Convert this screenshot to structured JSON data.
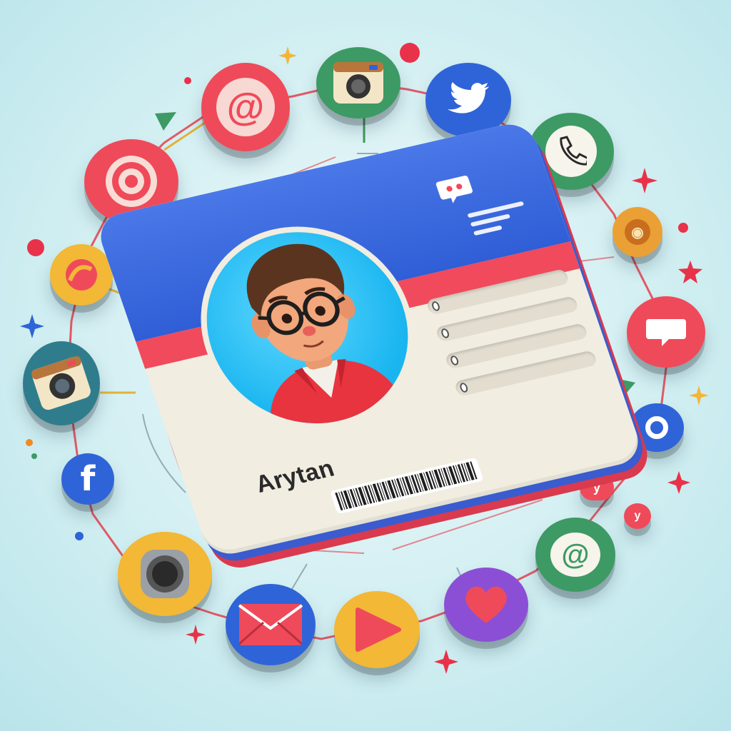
{
  "card": {
    "name": "Arytan"
  },
  "colors": {
    "background": "#cfeef1",
    "card_blue": "#2f5ed6",
    "card_red": "#f04a5c",
    "card_cream": "#f1ede1",
    "portrait_bg": "#19b5f0"
  },
  "icons": [
    "email-at-icon",
    "instagram-camera-icon",
    "twitter-bird-icon",
    "phone-icon",
    "target-icon",
    "messenger-icon",
    "chat-bubble-icon",
    "circle-ring-icon",
    "facebook-icon",
    "camera-lens-icon",
    "mail-envelope-icon",
    "play-icon",
    "heart-icon",
    "chat-swirl-icon"
  ]
}
